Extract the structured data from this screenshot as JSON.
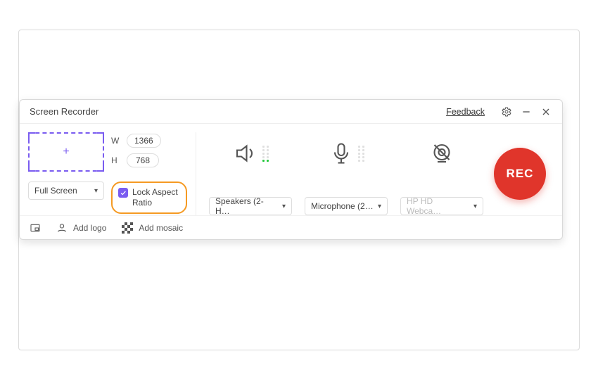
{
  "header": {
    "title": "Screen Recorder",
    "feedback": "Feedback"
  },
  "region": {
    "width_label": "W",
    "height_label": "H",
    "width": "1366",
    "height": "768",
    "mode": "Full Screen",
    "lock_label": "Lock Aspect Ratio",
    "lock_checked": true
  },
  "devices": {
    "speaker_select": "Speakers (2- H…",
    "mic_select": "Microphone (2…",
    "webcam_select": "HP HD Webca…"
  },
  "record": {
    "label": "REC"
  },
  "footer": {
    "add_logo": "Add logo",
    "add_mosaic": "Add mosaic"
  }
}
